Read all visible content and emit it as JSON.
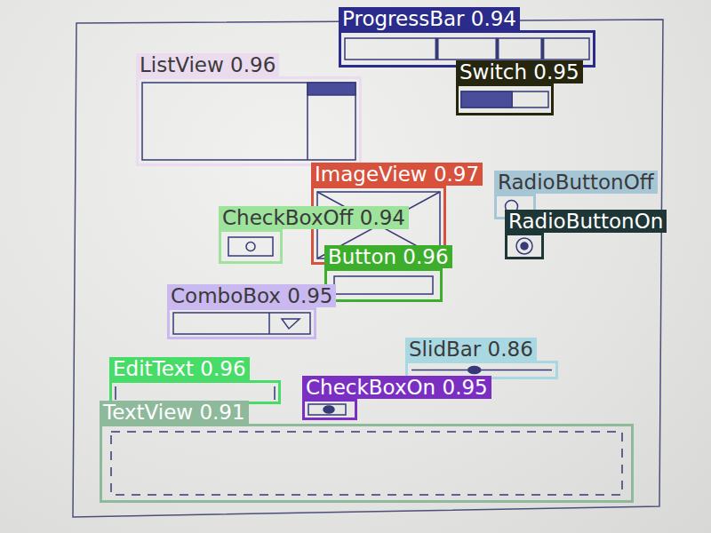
{
  "detections": [
    {
      "kind": "progressbar",
      "text": "ProgressBar 0.94",
      "color": "#2b2b8c"
    },
    {
      "kind": "switch",
      "text": "Switch 0.95",
      "color": "#26260f"
    },
    {
      "kind": "listview",
      "text": "ListView 0.96",
      "color": "#eadcee"
    },
    {
      "kind": "imageview",
      "text": "ImageView 0.97",
      "color": "#d8513d"
    },
    {
      "kind": "radiooff",
      "text": "RadioButtonOff",
      "color": "#a6c6d6"
    },
    {
      "kind": "radioon",
      "text": "RadioButtonOn",
      "color": "#1f3636"
    },
    {
      "kind": "checkboxoff",
      "text": "CheckBoxOff 0.94",
      "color": "#9ee39c"
    },
    {
      "kind": "button",
      "text": "Button 0.96",
      "color": "#3dae2b"
    },
    {
      "kind": "combobox",
      "text": "ComboBox 0.95",
      "color": "#cab9f1"
    },
    {
      "kind": "slider",
      "text": "SlidBar 0.86",
      "color": "#a9d8e2"
    },
    {
      "kind": "edittext",
      "text": "EditText 0.96",
      "color": "#47dc68"
    },
    {
      "kind": "checkboxon",
      "text": "CheckBoxOn 0.95",
      "color": "#7b2fc2"
    },
    {
      "kind": "textview",
      "text": "TextView 0.91",
      "color": "#8fb99b"
    }
  ]
}
